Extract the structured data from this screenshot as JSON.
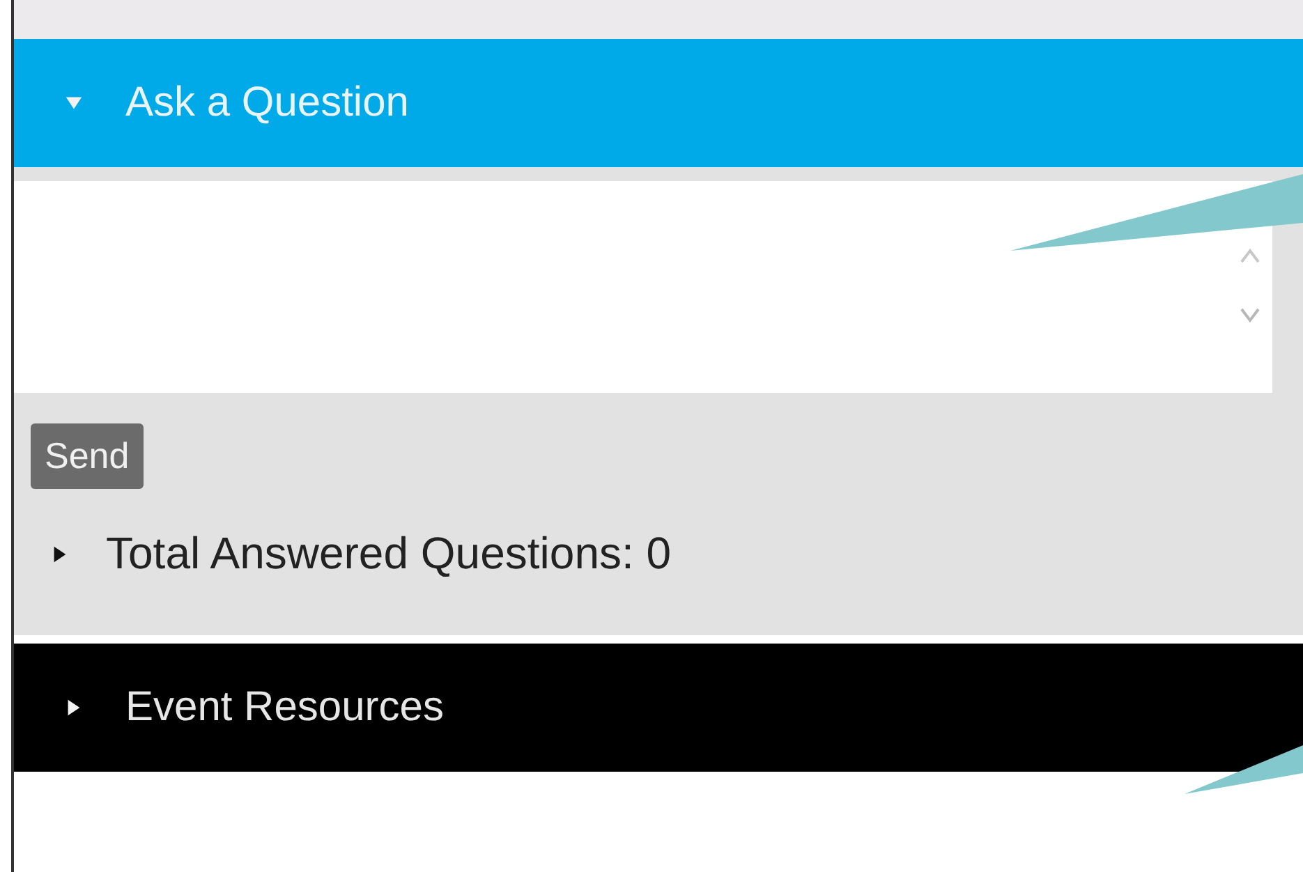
{
  "panels": [
    {
      "title": "Ask a Question",
      "expanded": true,
      "selected": true
    },
    {
      "title": "Event Resources",
      "expanded": false,
      "selected": false
    }
  ],
  "send_button": "Send",
  "answered": {
    "label": "Total Answered Questions: 0",
    "expanded": false
  }
}
